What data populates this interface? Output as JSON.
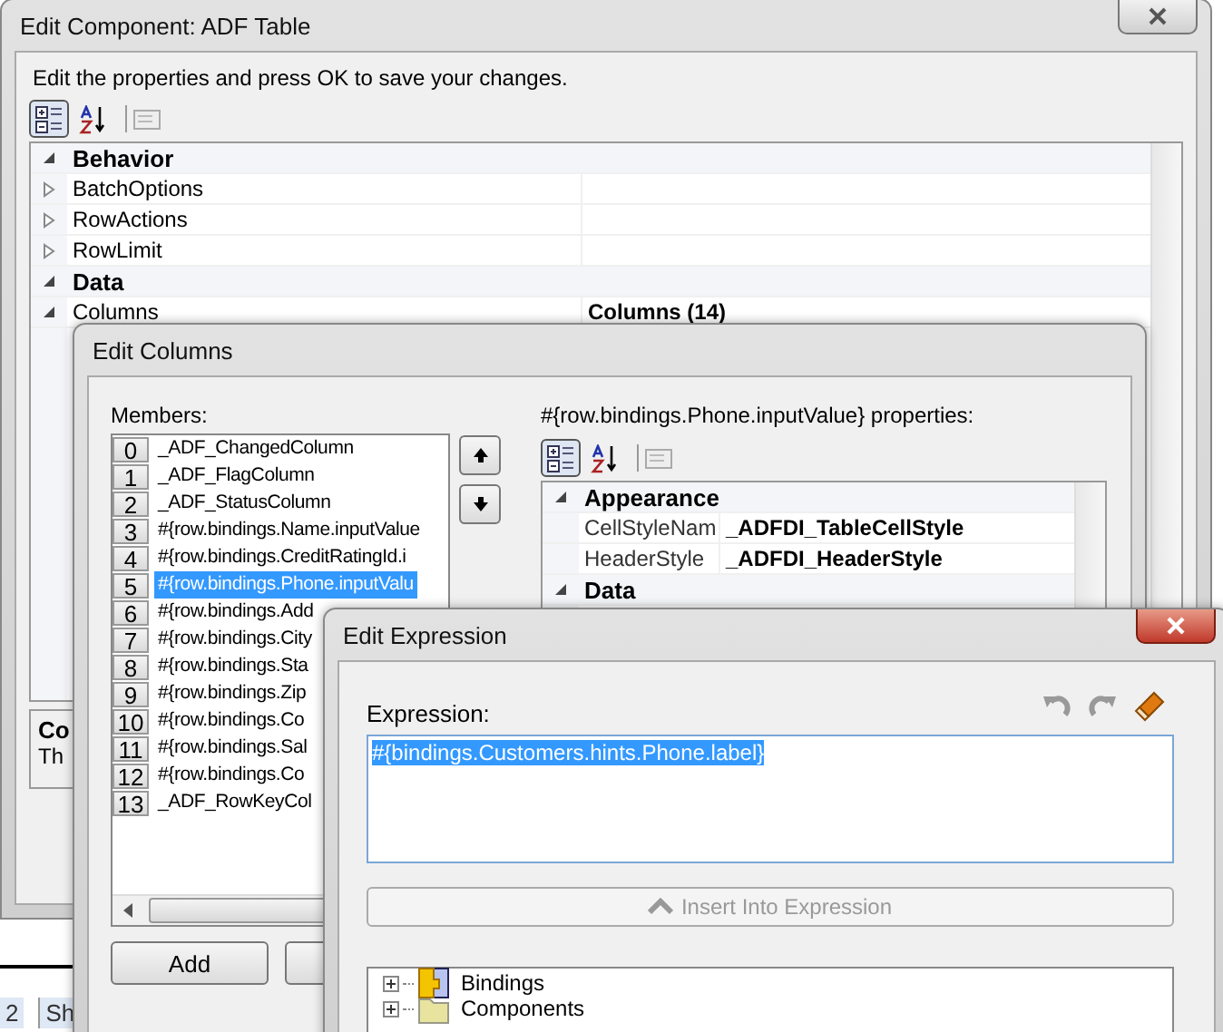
{
  "main_window": {
    "title": "Edit Component: ADF Table",
    "instructions": "Edit the properties and press OK to save your changes.",
    "toolbar": [
      {
        "kind": "categorized",
        "selected": true
      },
      {
        "kind": "alphabetical",
        "selected": false
      },
      {
        "kind": "pages",
        "selected": false
      }
    ],
    "properties": [
      {
        "kind": "category",
        "name": "Behavior",
        "expanded": true
      },
      {
        "kind": "property",
        "name": "BatchOptions",
        "expanded": false
      },
      {
        "kind": "property",
        "name": "RowActions",
        "expanded": false
      },
      {
        "kind": "property",
        "name": "RowLimit",
        "expanded": false
      },
      {
        "kind": "category",
        "name": "Data",
        "expanded": true
      },
      {
        "kind": "property",
        "name": "Columns",
        "value": "Columns (14)",
        "expanded": true
      }
    ],
    "description": {
      "title": "Co",
      "text": "Th"
    },
    "sheet_tabs": [
      "2",
      "Sh"
    ]
  },
  "edit_columns": {
    "title": "Edit Columns",
    "members_label": "Members:",
    "members": [
      {
        "index": "0",
        "name": "_ADF_ChangedColumn",
        "selected": false
      },
      {
        "index": "1",
        "name": "_ADF_FlagColumn",
        "selected": false
      },
      {
        "index": "2",
        "name": "_ADF_StatusColumn",
        "selected": false
      },
      {
        "index": "3",
        "name": "#{row.bindings.Name.inputValue",
        "selected": false
      },
      {
        "index": "4",
        "name": "#{row.bindings.CreditRatingId.i",
        "selected": false
      },
      {
        "index": "5",
        "name": "#{row.bindings.Phone.inputValu",
        "selected": true
      },
      {
        "index": "6",
        "name": "#{row.bindings.Add",
        "selected": false
      },
      {
        "index": "7",
        "name": "#{row.bindings.City",
        "selected": false
      },
      {
        "index": "8",
        "name": "#{row.bindings.Sta",
        "selected": false
      },
      {
        "index": "9",
        "name": "#{row.bindings.Zip",
        "selected": false
      },
      {
        "index": "10",
        "name": "#{row.bindings.Co",
        "selected": false
      },
      {
        "index": "11",
        "name": "#{row.bindings.Sal",
        "selected": false
      },
      {
        "index": "12",
        "name": "#{row.bindings.Co",
        "selected": false
      },
      {
        "index": "13",
        "name": "_ADF_RowKeyCol",
        "selected": false
      }
    ],
    "add_button": "Add",
    "properties_label": "#{row.bindings.Phone.inputValue} properties:",
    "toolbar": [
      {
        "kind": "categorized",
        "selected": true
      },
      {
        "kind": "alphabetical",
        "selected": false
      },
      {
        "kind": "pages",
        "selected": false
      }
    ],
    "properties": [
      {
        "kind": "category",
        "name": "Appearance",
        "expanded": true
      },
      {
        "kind": "property",
        "name": "CellStyleNam",
        "value": "_ADFDI_TableCellStyle"
      },
      {
        "kind": "property",
        "name": "HeaderStyle",
        "value": "_ADFDI_HeaderStyle"
      },
      {
        "kind": "category",
        "name": "Data",
        "expanded": true
      }
    ]
  },
  "edit_expression": {
    "title": "Edit Expression",
    "expression_label": "Expression:",
    "expression": "#{bindings.Customers.hints.Phone.label}",
    "insert_button": {
      "label": "Insert Into Expression",
      "disabled": true
    },
    "tree": [
      {
        "name": "Bindings",
        "kind": "bindings",
        "expanded": false
      },
      {
        "name": "Components",
        "kind": "folder",
        "expanded": false
      }
    ]
  }
}
